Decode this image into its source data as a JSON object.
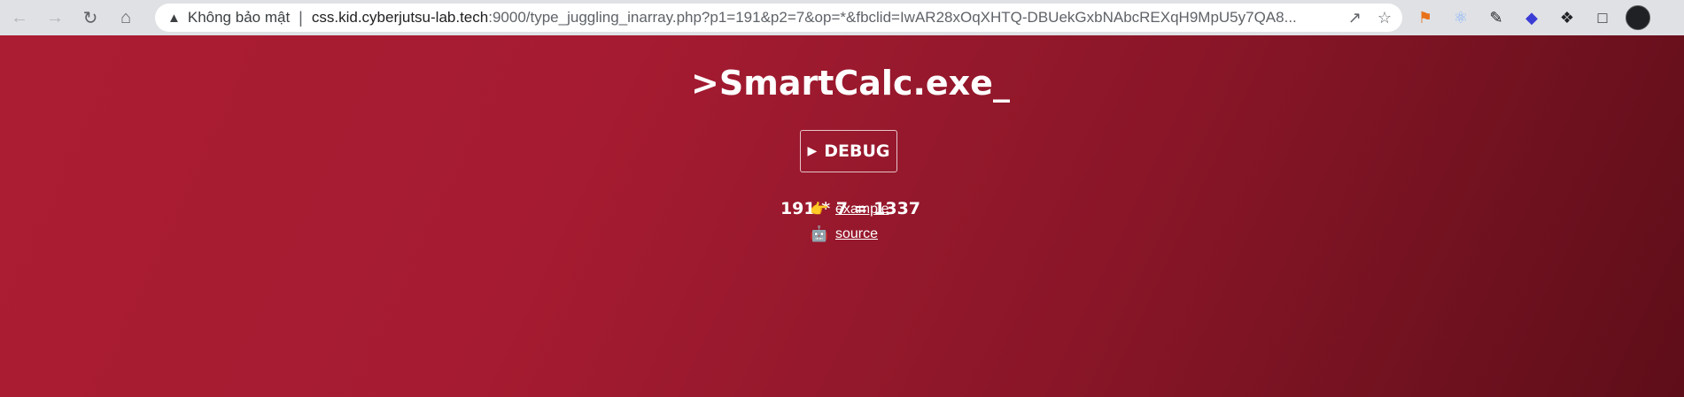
{
  "browser": {
    "security_label": "Không bảo mật",
    "url_host": "css.kid.cyberjutsu-lab.tech",
    "url_rest": ":9000/type_juggling_inarray.php?p1=191&p2=7&op=*&fbclid=IwAR28xOqXHTQ-DBUekGxbNAbcREXqH9MpU5y7QA8..."
  },
  "page": {
    "title": ">SmartCalc.exe_",
    "debug_label": "DEBUG",
    "result": "191 * 7 = 1337",
    "links": [
      {
        "label": "example",
        "icon": "pointing-hand-icon"
      },
      {
        "label": "source",
        "icon": "robot-face-icon"
      }
    ]
  },
  "colors": {
    "background_start": "#ab1d33",
    "background_end": "#5e0e19",
    "text": "#ffffff"
  }
}
